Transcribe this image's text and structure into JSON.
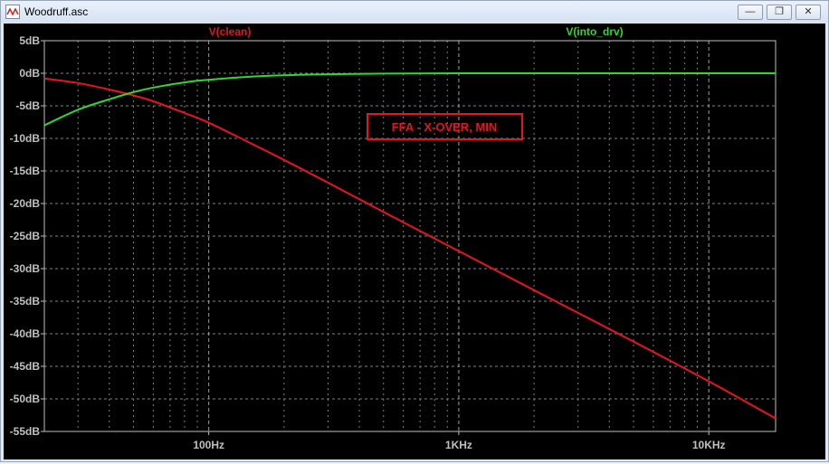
{
  "window": {
    "title": "Woodruff.asc",
    "minimize_glyph": "—",
    "restore_glyph": "❐",
    "close_glyph": "✕"
  },
  "colors": {
    "background": "#000000",
    "grid": "#7f7f7f",
    "axis_text": "#c0c0c0",
    "clean": "#e8141e",
    "into_drv": "#32d732",
    "annotation": "#e8141e"
  },
  "chart_data": {
    "type": "line",
    "x_scale": "log",
    "xlim_hz": [
      22,
      18500
    ],
    "ylim_db": [
      -55,
      5
    ],
    "grid": true,
    "y_ticks": [
      5,
      0,
      -5,
      -10,
      -15,
      -20,
      -25,
      -30,
      -35,
      -40,
      -45,
      -50,
      -55
    ],
    "y_tick_labels": [
      "5dB",
      "0dB",
      "-5dB",
      "-10dB",
      "-15dB",
      "-20dB",
      "-25dB",
      "-30dB",
      "-35dB",
      "-40dB",
      "-45dB",
      "-50dB",
      "-55dB"
    ],
    "x_ticks": [
      100,
      1000,
      10000
    ],
    "x_tick_labels": [
      "100Hz",
      "1KHz",
      "10KHz"
    ],
    "annotation": "FFA - X-OVER, MIN",
    "series": [
      {
        "name": "V(clean)",
        "color": "#e8141e",
        "x": [
          22,
          30,
          40,
          50,
          60,
          80,
          100,
          150,
          200,
          300,
          500,
          1000,
          2000,
          5000,
          10000,
          18500
        ],
        "y": [
          -0.8,
          -1.5,
          -2.5,
          -3.4,
          -4.3,
          -6.1,
          -7.6,
          -10.9,
          -13.3,
          -16.8,
          -21.3,
          -27.3,
          -33.3,
          -41.2,
          -47.3,
          -53.0
        ]
      },
      {
        "name": "V(into_drv)",
        "color": "#32d732",
        "x": [
          22,
          30,
          40,
          50,
          60,
          80,
          100,
          150,
          200,
          300,
          500,
          1000,
          2000,
          5000,
          10000,
          18500
        ],
        "y": [
          -8.0,
          -5.6,
          -4.0,
          -2.9,
          -2.2,
          -1.4,
          -1.0,
          -0.5,
          -0.3,
          -0.15,
          -0.05,
          0,
          0,
          0,
          0,
          0
        ]
      }
    ]
  }
}
